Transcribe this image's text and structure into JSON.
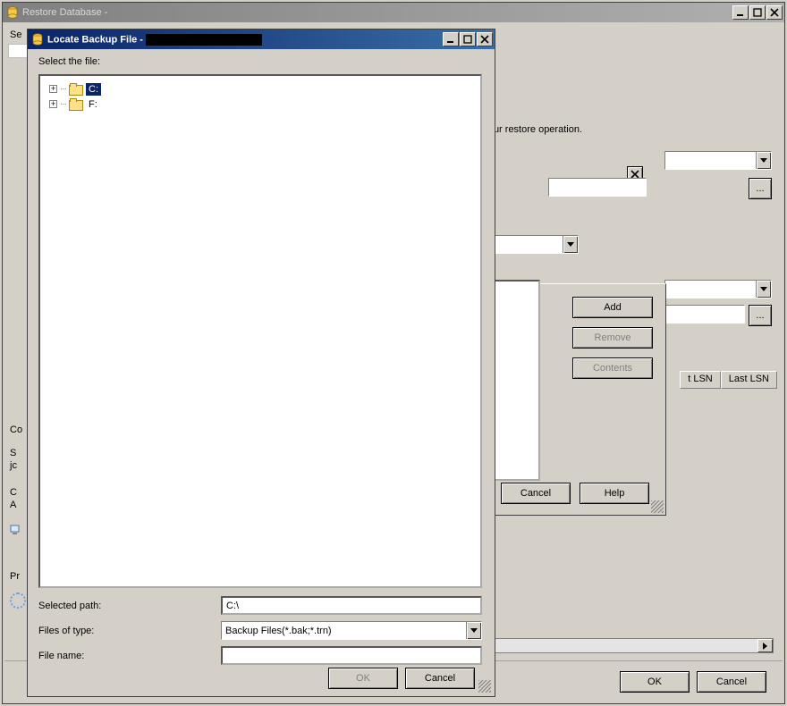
{
  "restore_window": {
    "title": "Restore Database - ",
    "sidebar_section1": "Se",
    "sidebar_section2": "Co",
    "sidebar_letters": {
      "s": "S",
      "jc": "jc",
      "c": "C",
      "a": "A"
    },
    "sidebar_section3": "Pr",
    "hint": "ase for your restore operation.",
    "add": "Add",
    "remove": "Remove",
    "contents": "Contents",
    "cancel": "Cancel",
    "help": "Help",
    "ok": "OK",
    "th1": "t LSN",
    "th2": "Last LSN",
    "ellipsis": "..."
  },
  "locate_window": {
    "title": "Locate Backup File - ",
    "select_the_file": "Select the file:",
    "drives": [
      {
        "label": "C:",
        "selected": true
      },
      {
        "label": "F:",
        "selected": false
      }
    ],
    "selected_path_label": "Selected path:",
    "selected_path_value": "C:\\",
    "files_of_type_label": "Files of type:",
    "files_of_type_value": "Backup Files(*.bak;*.trn)",
    "file_name_label": "File name:",
    "file_name_value": "",
    "ok": "OK",
    "cancel": "Cancel"
  }
}
